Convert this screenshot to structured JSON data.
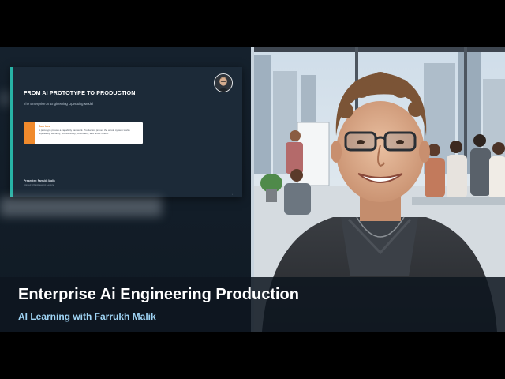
{
  "slide": {
    "title": "FROM AI PROTOTYPE TO PRODUCTION",
    "subtitle": "The Enterprise AI Engineering Operating Model",
    "callout_label": "Core Idea",
    "callout_text": "A prototype proves a capability can work. Production proves the whole system works repeatedly, securely, economically, observably, and under failure.",
    "presenter": "Presenter: Farrukh Malik",
    "presenter_sub": "Applied AI Engineering Lecture"
  },
  "lower_third": {
    "title": "Enterprise Ai Engineering Production",
    "subtitle": "AI Learning with Farrukh Malik"
  },
  "colors": {
    "accent_teal": "#27b3a6",
    "accent_orange": "#f08a2c",
    "subtitle_blue": "#9fd4f5"
  }
}
